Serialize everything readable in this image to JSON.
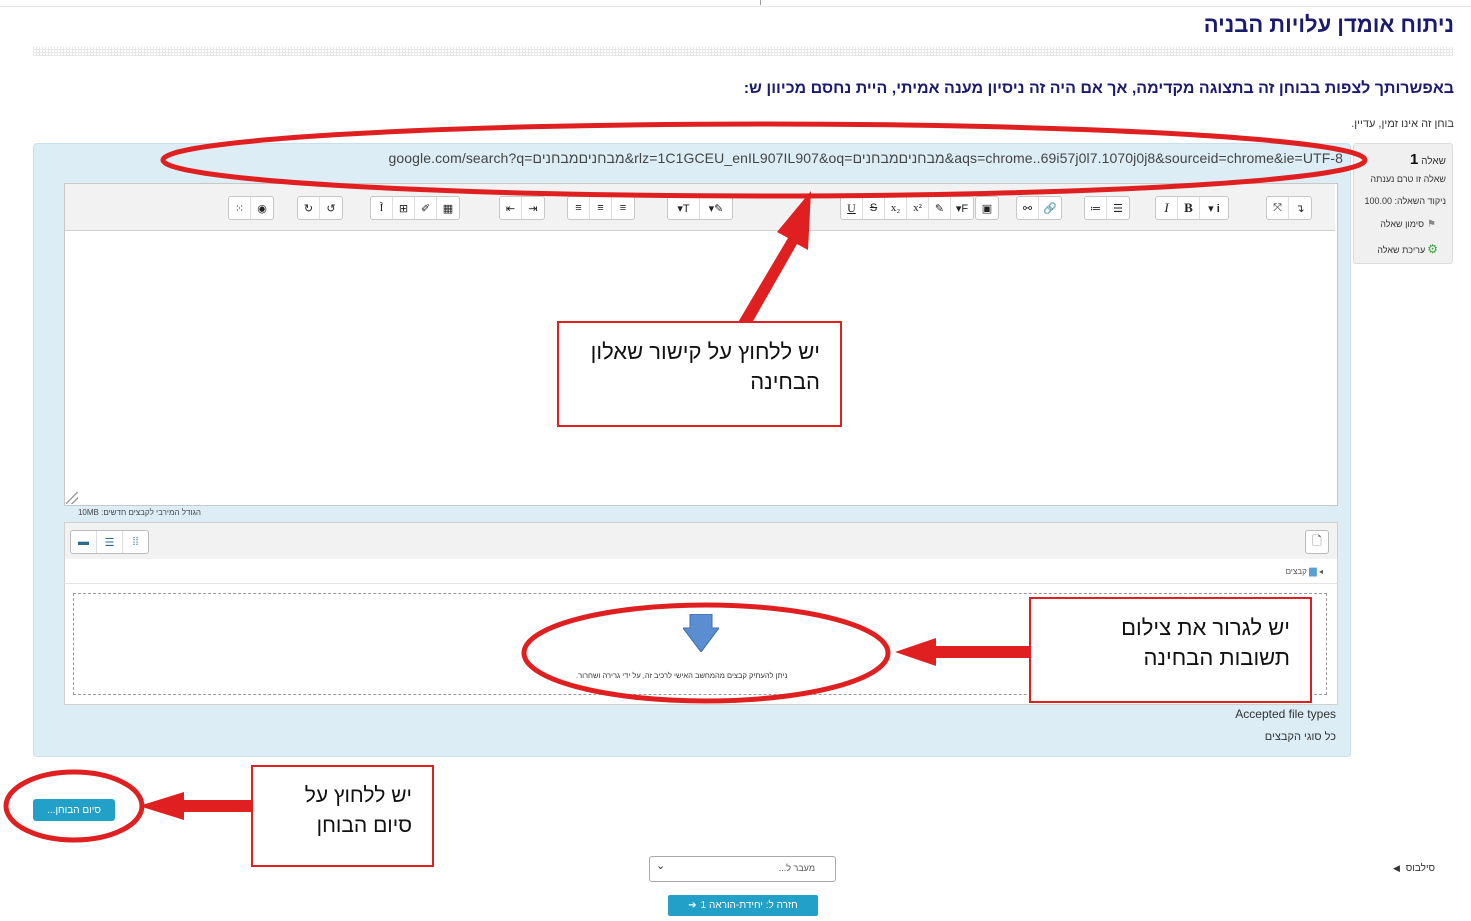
{
  "page": {
    "title": "ניתוח אומדן עלויות הבניה",
    "preview_notice": "באפשרותך לצפות בבוחן זה בתצוגה מקדימה, אך אם היה זה ניסיון מענה אמיתי, היית נחסם מכיוון ש:",
    "not_timed": "בוחן זה אינו זמין, עדיין."
  },
  "question_info": {
    "label": "שאלה",
    "number": "1",
    "state": "שאלה זו טרם נענתה",
    "grade": "ניקוד השאלה: 100.00",
    "flag": "סימון שאלה",
    "edit": "עריכת שאלה"
  },
  "question_text": "google.com/search?q=מבחניםמבחנים&rlz=1C1GCEU_enIL907IL907&oq=מבחניםמבחנים&aqs=chrome..69i57j0l7.1070j0j8&sourceid=chrome&ie=UTF-8",
  "filemanager": {
    "max_size": "הגודל המירבי לקבצים חדשים: 10MB",
    "path": "קבצים",
    "drop_hint": "ניתן להעתיק קבצים מהמחשב האישי לרכיב זה, על ידי גרירה ושחרור.",
    "accepted_label": "Accepted file types",
    "accepted_value": "כל סוגי הקבצים"
  },
  "finish_button": "סיום הבוחן...",
  "navigation": {
    "jump_to": "מעבר ל...",
    "return_to": "חזרה ל: יחידת-הוראה 1",
    "syllabus": "סילבוס"
  },
  "annotations": {
    "editor_callout": "יש ללחוץ על קישור שאלון הבחינה",
    "drop_callout": "יש לגרור את צילום תשובות הבחינה",
    "finish_callout": "יש ללחוץ על סיום הבוחן"
  },
  "colors": {
    "title": "#1a1a6e",
    "panel_bg": "#dcedf6",
    "button": "#22a0c8",
    "annotation": "#e02020"
  },
  "icons": {
    "flag": "flag-icon",
    "gear": "gear-icon",
    "folder": "folder-icon",
    "upload": "down-arrow-icon"
  }
}
